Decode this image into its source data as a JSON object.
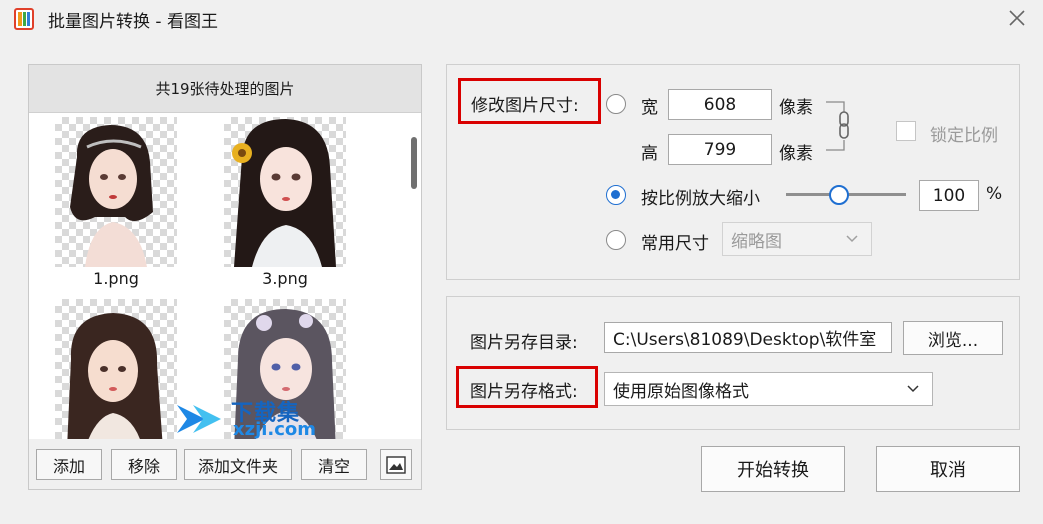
{
  "window": {
    "title": "批量图片转换 - 看图王"
  },
  "left_panel": {
    "header": "共19张待处理的图片",
    "thumbnails": [
      {
        "name": "1.png"
      },
      {
        "name": "3.png"
      },
      {
        "name": ""
      },
      {
        "name": ""
      }
    ],
    "watermark": {
      "top": "下载集",
      "bottom": "xzji.com"
    },
    "buttons": {
      "add": "添加",
      "remove": "移除",
      "add_folder": "添加文件夹",
      "clear": "清空"
    }
  },
  "resize": {
    "label": "修改图片尺寸:",
    "width_label": "宽",
    "width_value": "608",
    "width_unit": "像素",
    "height_label": "高",
    "height_value": "799",
    "height_unit": "像素",
    "lock_ratio_label": "锁定比例",
    "scale_label": "按比例放大缩小",
    "scale_value": "100",
    "scale_unit": "%",
    "common_label": "常用尺寸",
    "common_value": "缩略图",
    "selected_option": "scale"
  },
  "output": {
    "dir_label": "图片另存目录:",
    "dir_value": "C:\\Users\\81089\\Desktop\\软件室",
    "browse_label": "浏览...",
    "format_label": "图片另存格式:",
    "format_value": "使用原始图像格式"
  },
  "actions": {
    "start": "开始转换",
    "cancel": "取消"
  },
  "colors": {
    "accent": "#1f6fd1",
    "highlight_red": "#d90000"
  }
}
